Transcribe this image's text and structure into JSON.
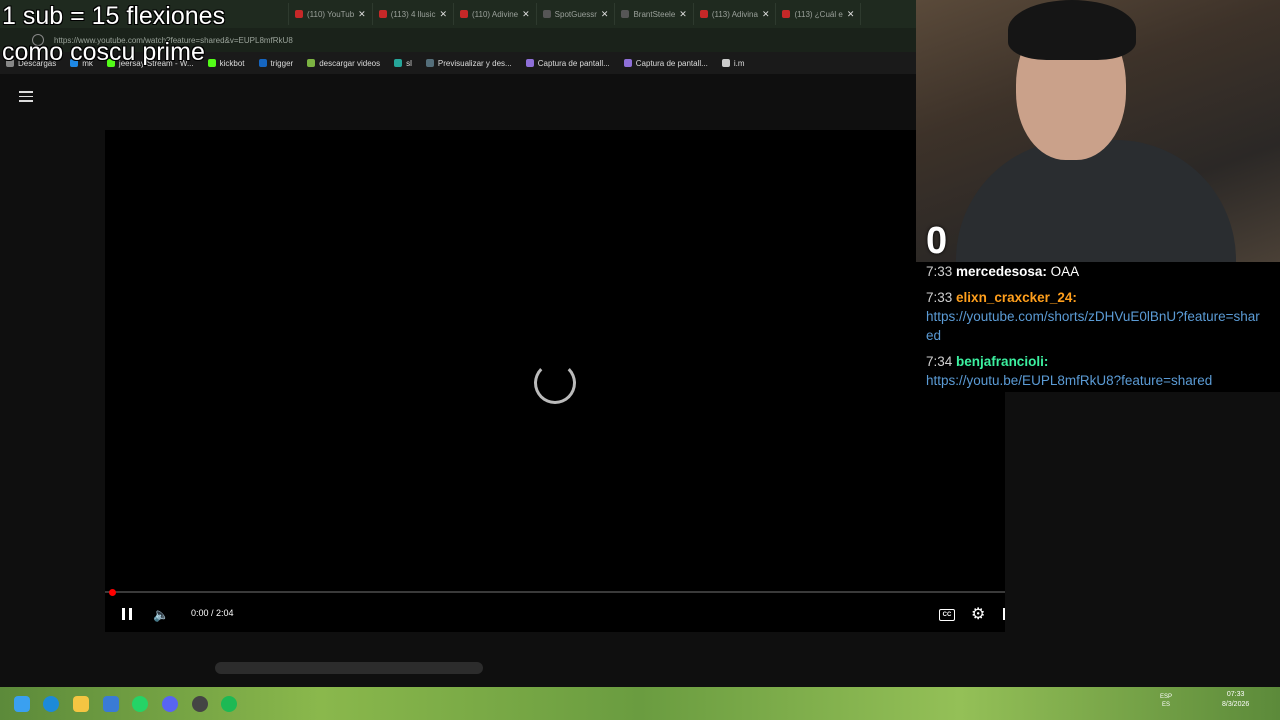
{
  "browser": {
    "tabs": [
      {
        "label": ""
      },
      {
        "label": "(110) YouTub"
      },
      {
        "label": "(113) 4 llusic"
      },
      {
        "label": "(110) Adivine"
      },
      {
        "label": "SpotGuessr"
      },
      {
        "label": "BrantSteele"
      },
      {
        "label": "(113) Adivina"
      },
      {
        "label": "(113) ¿Cuál e"
      }
    ],
    "url": "https://www.youtube.com/watch?feature=shared&v=EUPL8mfRkU8",
    "bookmarks": [
      {
        "label": "Descargas",
        "color": "#888888"
      },
      {
        "label": "mk",
        "color": "#1e88e5"
      },
      {
        "label": "jeersay Stream - W...",
        "color": "#53fc18"
      },
      {
        "label": "kickbot",
        "color": "#53fc18"
      },
      {
        "label": "trigger",
        "color": "#1565c0"
      },
      {
        "label": "descargar videos",
        "color": "#7cb342"
      },
      {
        "label": "sl",
        "color": "#26a69a"
      },
      {
        "label": "Previsualizar y des...",
        "color": "#546e7a"
      },
      {
        "label": "Captura de pantall...",
        "color": "#8e6fd8"
      },
      {
        "label": "Captura de pantall...",
        "color": "#8e6fd8"
      },
      {
        "label": "i.m",
        "color": "#cccccc"
      }
    ]
  },
  "overlay": {
    "line1": "1 sub = 15 flexiones",
    "line2": "como coscu prime"
  },
  "player": {
    "time": "0:00 / 2:04",
    "progress": 0,
    "cc_label": "CC"
  },
  "stream": {
    "counter": "0"
  },
  "chat": {
    "messages": [
      {
        "time": "7:33",
        "user": "mercedesosa:",
        "text": "OAA",
        "user_color": "#ffffff"
      },
      {
        "time": "7:33",
        "user": "elixn_craxcker_24:",
        "text": "https://youtube.com/shorts/zDHVuE0lBnU?feature=shared",
        "user_color": "#ff9f1c"
      },
      {
        "time": "7:34",
        "user": "benjafrancioli:",
        "text": "https://youtu.be/EUPL8mfRkU8?feature=shared",
        "user_color": "#3cf0a0"
      }
    ]
  },
  "taskbar": {
    "lang_top": "ESP",
    "lang_bottom": "ES",
    "clock_time": "07:33",
    "clock_date": "8/3/2026"
  }
}
